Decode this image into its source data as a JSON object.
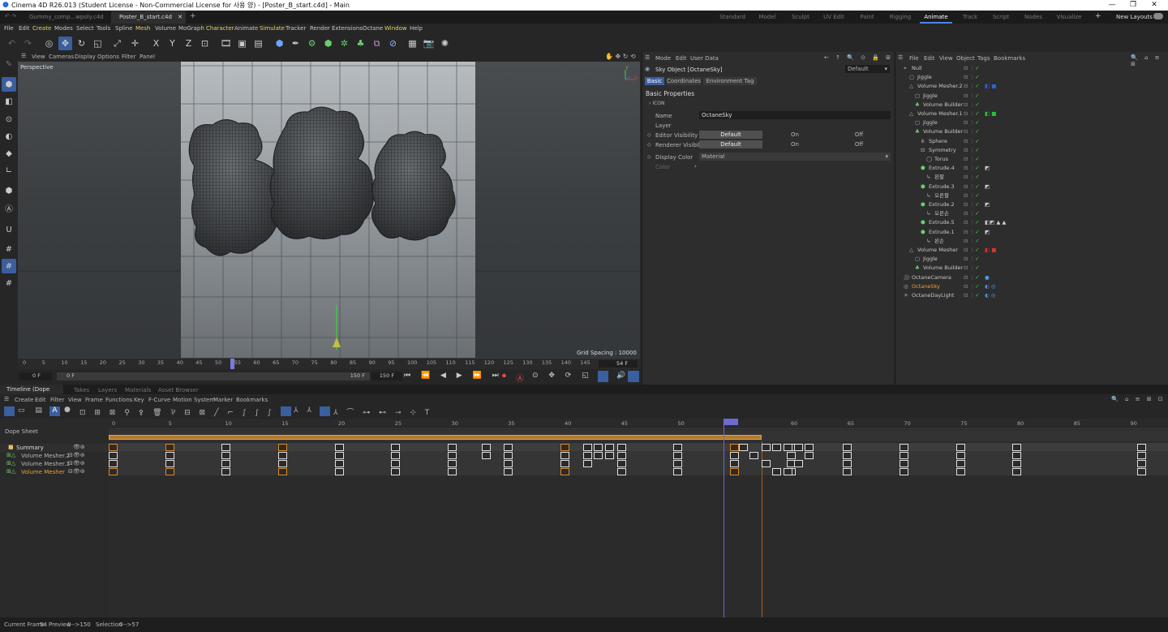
{
  "window": {
    "title": "Cinema 4D R26.013 (Student License - Non-Commercial License for 사용 양) - [Poster_B_start.c4d] - Main"
  },
  "doc_tabs": [
    "Gummy_comp...wpoly.c4d *",
    "Poster_B_start.c4d"
  ],
  "layouts": [
    "Standard",
    "Model",
    "Sculpt",
    "UV Edit",
    "Paint",
    "Rigging",
    "Animate",
    "Track",
    "Script",
    "Nodes",
    "Visualize"
  ],
  "new_layouts": "New Layouts",
  "menu": [
    "File",
    "Edit",
    "Create",
    "Modes",
    "Select",
    "Tools",
    "Spline",
    "Mesh",
    "Volume",
    "MoGraph",
    "Character",
    "Animate",
    "Simulate",
    "Tracker",
    "Render",
    "Extensions",
    "Octane",
    "Window",
    "Help"
  ],
  "viewport": {
    "menu": [
      "View",
      "Cameras",
      "Display",
      "Options",
      "Filter",
      "Panel"
    ],
    "label": "Perspective",
    "grid_spacing": "Grid Spacing : 10000 cm",
    "axis_y": "Y",
    "axis_x": "X"
  },
  "timeline_ruler": {
    "ticks": [
      "0",
      "5",
      "10",
      "15",
      "20",
      "25",
      "30",
      "35",
      "40",
      "45",
      "50",
      "55",
      "60",
      "65",
      "70",
      "75",
      "80",
      "85",
      "90",
      "95",
      "100",
      "105",
      "110",
      "115",
      "120",
      "125",
      "130",
      "135",
      "140",
      "145",
      "150"
    ],
    "current": "54 F"
  },
  "timeline_controls": {
    "start": "0 F",
    "start2": "0 F",
    "end": "150 F",
    "end2": "150 F"
  },
  "attributes": {
    "menu": [
      "Mode",
      "Edit",
      "User Data"
    ],
    "title": "Sky Object [OctaneSky]",
    "preset": "Default",
    "tabs": [
      "Basic",
      "Coordinates",
      "Environment Tag"
    ],
    "section": "Basic Properties",
    "icon_row": "ICON",
    "name_label": "Name",
    "name_value": "OctaneSky",
    "layer_label": "Layer",
    "editor_vis": "Editor Visibility",
    "renderer_vis": "Renderer Visibility",
    "default": "Default",
    "on": "On",
    "off": "Off",
    "display_color": "Display Color",
    "display_color_value": "Material",
    "color": "Color"
  },
  "objects": {
    "menu": [
      "File",
      "Edit",
      "View",
      "Object",
      "Tags",
      "Bookmarks"
    ],
    "items": [
      {
        "name": "Null",
        "indent": 0
      },
      {
        "name": "Jiggle",
        "indent": 1
      },
      {
        "name": "Volume Mesher.2",
        "indent": 1
      },
      {
        "name": "Jiggle",
        "indent": 2
      },
      {
        "name": "Volume Builder",
        "indent": 2
      },
      {
        "name": "Volume Mesher.1",
        "indent": 1
      },
      {
        "name": "Jiggle",
        "indent": 2
      },
      {
        "name": "Volume Builder",
        "indent": 2
      },
      {
        "name": "Sphere",
        "indent": 3
      },
      {
        "name": "Symmetry",
        "indent": 3
      },
      {
        "name": "Torus",
        "indent": 4
      },
      {
        "name": "Extrude.4",
        "indent": 3
      },
      {
        "name": "왼팔",
        "indent": 4
      },
      {
        "name": "Extrude.3",
        "indent": 3
      },
      {
        "name": "오른팔",
        "indent": 4
      },
      {
        "name": "Extrude.2",
        "indent": 3
      },
      {
        "name": "오른손",
        "indent": 4
      },
      {
        "name": "Extrude.5",
        "indent": 3
      },
      {
        "name": "Extrude.1",
        "indent": 3
      },
      {
        "name": "왼손",
        "indent": 4
      },
      {
        "name": "Volume Mesher",
        "indent": 1
      },
      {
        "name": "Jiggle",
        "indent": 2
      },
      {
        "name": "Volume Builder",
        "indent": 2
      },
      {
        "name": "OctaneCamera",
        "indent": 0
      },
      {
        "name": "OctaneSky",
        "indent": 0
      },
      {
        "name": "OctaneDayLight",
        "indent": 0
      }
    ]
  },
  "timeline": {
    "tabs": [
      "Timeline (Dope Sheet)",
      "Takes",
      "Layers",
      "Materials",
      "Asset Browser"
    ],
    "menu": [
      "Create",
      "Edit",
      "Filter",
      "View",
      "Frame",
      "Functions",
      "Key",
      "F-Curve",
      "Motion System",
      "Marker",
      "Bookmarks"
    ],
    "dope_sheet": "Dope Sheet",
    "tracks": [
      "Summary",
      "Volume Mesher.2",
      "Volume Mesher.1",
      "Volume Mesher"
    ],
    "ruler": [
      "0",
      "5",
      "10",
      "15",
      "20",
      "25",
      "30",
      "35",
      "40",
      "45",
      "50",
      "54",
      "60",
      "65",
      "70",
      "75",
      "80",
      "85",
      "90"
    ]
  },
  "status": {
    "current_frame_label": "Current Frame",
    "current_frame": "54",
    "preview_label": "Preview",
    "preview": "0-->150",
    "selection_label": "Selection",
    "selection": "0-->57"
  }
}
